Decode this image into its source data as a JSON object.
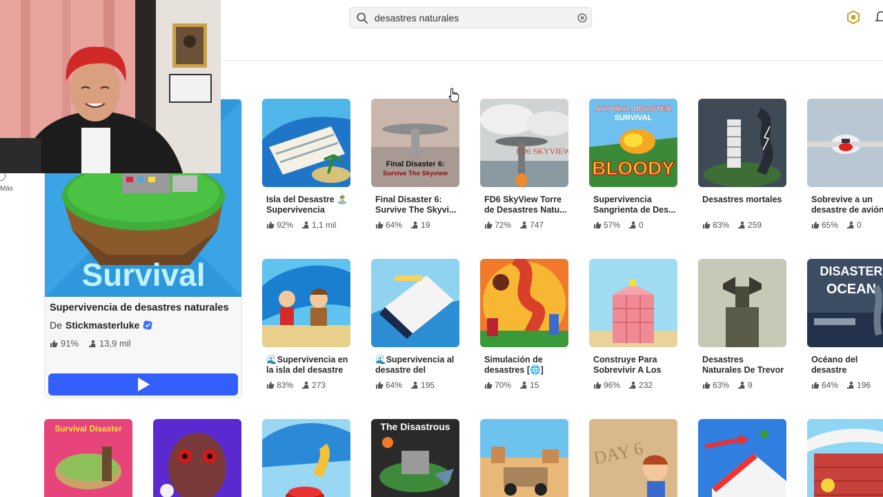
{
  "search": {
    "query": "desastres naturales"
  },
  "sidebar": {
    "more_label": "Más"
  },
  "featured": {
    "title": "Supervivencia de desastres naturales",
    "by_prefix": "De",
    "creator": "Stickmasterluke",
    "rating": "91%",
    "players": "13,9 mil",
    "thumb_text": "Survival",
    "colors": {
      "play": "#335fff",
      "sky": "#2f97dc"
    }
  },
  "games": [
    {
      "name": "Isla del Desastre 🏝️ Supervivencia",
      "rating": "92%",
      "players": "1,1 mil"
    },
    {
      "name": "Final Disaster 6: Survive The Skyvi...",
      "rating": "64%",
      "players": "19",
      "thumb_text_1": "Final Disaster 6:",
      "thumb_text_2": "Survive The Skyview"
    },
    {
      "name": "FD6 SkyView Torre de Desastres Natu...",
      "rating": "72%",
      "players": "747",
      "thumb_text": "FD6 SKYVIEW"
    },
    {
      "name": "Supervivencia Sangrienta de Des...",
      "rating": "57%",
      "players": "0",
      "thumb_text_1": "NATURAL DISASTER",
      "thumb_text_2": "SURVIVAL",
      "thumb_text_3": "BLOODY"
    },
    {
      "name": "Desastres mortales",
      "rating": "83%",
      "players": "259"
    },
    {
      "name": "Sobrevive a un desastre de avión",
      "rating": "65%",
      "players": "0"
    },
    {
      "name": "🌊Supervivencia en la isla del desastre",
      "rating": "83%",
      "players": "273"
    },
    {
      "name": "🌊Supervivencia al desastre del tsuna...",
      "rating": "64%",
      "players": "195"
    },
    {
      "name": "Simulación de desastres [🌐]",
      "rating": "70%",
      "players": "15"
    },
    {
      "name": "Construye Para Sobrevivir A Los D...",
      "rating": "96%",
      "players": "232"
    },
    {
      "name": "Desastres Naturales De Trevor",
      "rating": "63%",
      "players": "9"
    },
    {
      "name": "Océano del desastre",
      "rating": "64%",
      "players": "196",
      "thumb_text_1": "DISASTER",
      "thumb_text_2": "OCEAN"
    }
  ],
  "row3": [
    {
      "thumb_text_1": "Survival Disaster"
    },
    {},
    {},
    {
      "thumb_text_1": "The Disastrous"
    },
    {},
    {
      "thumb_text_1": "DAY 6"
    },
    {},
    {}
  ],
  "icons": {
    "search": "search-icon",
    "clear": "clear-icon",
    "robux": "robux-icon",
    "bell": "bell-icon",
    "thumb": "thumbs-up-icon",
    "players": "players-icon",
    "play": "play-icon"
  }
}
